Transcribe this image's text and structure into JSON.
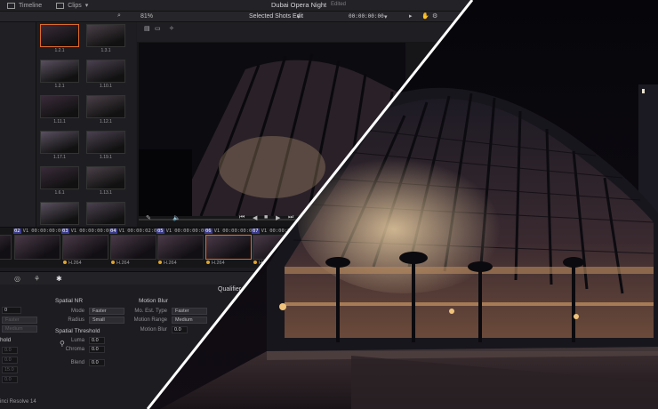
{
  "app": {
    "tab_timeline": "Timeline",
    "tab_clips": "Clips",
    "project_title": "Dubai Opera Night",
    "project_status": "Edited",
    "footer_name": "inci Resolve 14"
  },
  "viewer": {
    "zoom": "81%",
    "clip_filter": "Selected Shots Edit",
    "timecode": "00:00:00:00"
  },
  "media_pool": [
    {
      "label": "1.2.1"
    },
    {
      "label": "1.3.1"
    },
    {
      "label": "1.2.1"
    },
    {
      "label": "1.10.1"
    },
    {
      "label": "1.11.1"
    },
    {
      "label": "1.12.1"
    },
    {
      "label": "1.17.1"
    },
    {
      "label": "1.19.1"
    },
    {
      "label": "1.6.1"
    },
    {
      "label": "1.13.1"
    },
    {
      "label": ""
    },
    {
      "label": ""
    }
  ],
  "clip_strip": [
    {
      "num": "",
      "track": "V1",
      "tc": "",
      "codec": ""
    },
    {
      "num": "02",
      "track": "V1",
      "tc": "00:00:00:00",
      "codec": ""
    },
    {
      "num": "03",
      "track": "V1",
      "tc": "00:00:00:00",
      "codec": "H.264"
    },
    {
      "num": "04",
      "track": "V1",
      "tc": "00:00:02:00",
      "codec": "H.264"
    },
    {
      "num": "05",
      "track": "V1",
      "tc": "00:00:00:00",
      "codec": "H.264"
    },
    {
      "num": "06",
      "track": "V1",
      "tc": "00:00:00:00",
      "codec": "H.264"
    },
    {
      "num": "07",
      "track": "V1",
      "tc": "00:00:00",
      "codec": "H.264"
    }
  ],
  "panel": {
    "qualifier_tab": "Qualifier",
    "spatial_nr": {
      "title": "Spatial NR",
      "mode_label": "Mode",
      "mode_value": "Faster",
      "radius_label": "Radius",
      "radius_value": "Small",
      "threshold_title": "Spatial Threshold",
      "luma_label": "Luma",
      "luma_value": "0.0",
      "chroma_label": "Chroma",
      "chroma_value": "0.0",
      "blend_label": "Blend",
      "blend_value": "0.0"
    },
    "motion_blur": {
      "title": "Motion Blur",
      "est_label": "Mo. Est. Type",
      "est_value": "Faster",
      "range_label": "Motion Range",
      "range_value": "Medium",
      "blur_label": "Motion Blur",
      "blur_value": "0.0"
    },
    "temporal": {
      "frames_value": "0",
      "mode_value": "Faster",
      "range_value": "Medium",
      "threshold_title": "hold",
      "v1": "0.0",
      "v2": "0.0",
      "v3": "15.0",
      "v4": "0.0"
    }
  },
  "colors": {
    "accent": "#e06a2c",
    "track_badge": "#3b3b8f"
  }
}
